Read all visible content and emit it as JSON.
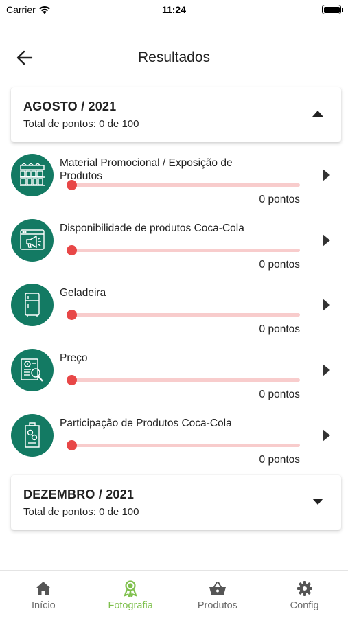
{
  "status_bar": {
    "carrier": "Carrier",
    "time": "11:24"
  },
  "header": {
    "title": "Resultados"
  },
  "months": [
    {
      "title": "AGOSTO / 2021",
      "total": "Total de pontos: 0 de 100",
      "expanded": true,
      "categories": [
        {
          "name": "Material Promocional / Exposição de Produtos",
          "points": "0 pontos",
          "progress": 0,
          "icon": "store-shelf-icon"
        },
        {
          "name": "Disponibilidade de produtos Coca-Cola",
          "points": "0 pontos",
          "progress": 0,
          "icon": "megaphone-screen-icon"
        },
        {
          "name": "Geladeira",
          "points": "0 pontos",
          "progress": 0,
          "icon": "fridge-icon"
        },
        {
          "name": "Preço",
          "points": "0 pontos",
          "progress": 0,
          "icon": "price-search-icon"
        },
        {
          "name": "Participação de Produtos Coca-Cola",
          "points": "0 pontos",
          "progress": 0,
          "icon": "product-tag-icon"
        }
      ]
    },
    {
      "title": "DEZEMBRO / 2021",
      "total": "Total de pontos: 0 de 100",
      "expanded": false
    }
  ],
  "tabs": [
    {
      "label": "Início",
      "icon": "home-icon",
      "active": false
    },
    {
      "label": "Fotografia",
      "icon": "award-icon",
      "active": true
    },
    {
      "label": "Produtos",
      "icon": "basket-icon",
      "active": false
    },
    {
      "label": "Config",
      "icon": "gear-icon",
      "active": false
    }
  ],
  "colors": {
    "icon_circle": "#137a63",
    "progress_track": "#f8cccc",
    "progress_thumb": "#e84747",
    "tab_active": "#7fc04d",
    "tab_inactive": "#6b6b6b"
  }
}
